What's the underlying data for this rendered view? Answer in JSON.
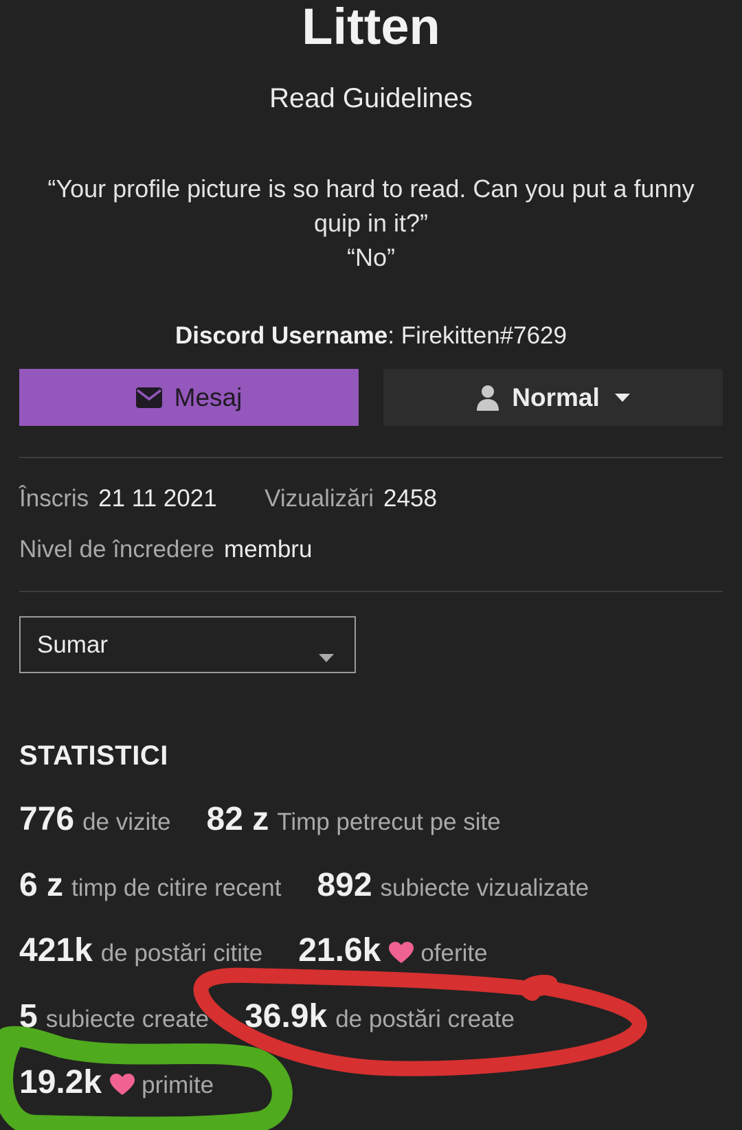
{
  "profile": {
    "name": "Litten",
    "guidelines_link": "Read Guidelines",
    "bio_line1": "“Your profile picture is so hard to read. Can you put a funny",
    "bio_line2": "quip in it?”",
    "bio_line3": "“No”",
    "discord_label": "Discord Username",
    "discord_value": ": Firekitten#7629"
  },
  "actions": {
    "message_label": "Mesaj",
    "notification_level": "Normal"
  },
  "meta": {
    "joined_label": "Înscris",
    "joined_value": "21 11 2021",
    "views_label": "Vizualizări",
    "views_value": "2458",
    "trust_label": "Nivel de încredere",
    "trust_value": "membru"
  },
  "filter": {
    "selected": "Sumar"
  },
  "stats": {
    "heading": "STATISTICI",
    "rows": [
      [
        {
          "value": "776",
          "label": "de vizite"
        },
        {
          "value": "82 z",
          "label": "Timp petrecut pe site"
        }
      ],
      [
        {
          "value": "6 z",
          "label": "timp de citire recent"
        },
        {
          "value": "892",
          "label": "subiecte vizualizate"
        }
      ],
      [
        {
          "value": "421k",
          "label": "de postări citite"
        },
        {
          "value": "21.6k",
          "label": "oferite"
        }
      ],
      [
        {
          "value": "5",
          "label": "subiecte create"
        },
        {
          "value": "36.9k",
          "label": "de postări create"
        }
      ],
      [
        {
          "value": "19.2k",
          "label": "primite"
        }
      ]
    ]
  },
  "colors": {
    "background": "#222222",
    "accent": "#9457bc",
    "heart": "#f06292",
    "annotation_red": "#d63030",
    "annotation_green": "#4faa1e"
  }
}
